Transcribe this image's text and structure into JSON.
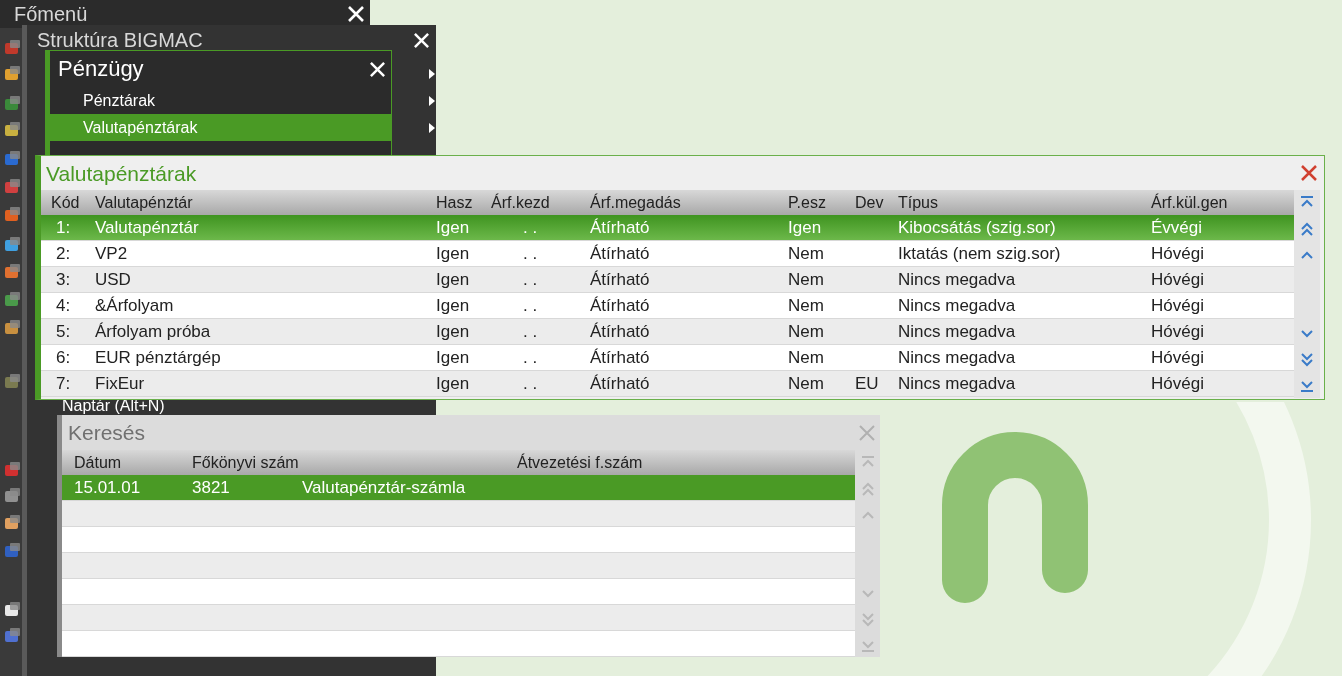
{
  "main_menu": {
    "title": "Főmenü"
  },
  "structure_window": {
    "title": "Struktúra BIGMAC",
    "items": [
      {
        "label": "Naptár (Alt+N)"
      }
    ]
  },
  "finance_menu": {
    "title": "Pénzügy",
    "items": [
      {
        "label": "Pénztárak",
        "selected": false
      },
      {
        "label": "Valutapénztárak",
        "selected": true
      }
    ]
  },
  "currency_window": {
    "title": "Valutapénztárak",
    "table": {
      "columns": [
        "Kód",
        "Valutapénztár",
        "Hasz",
        "Árf.kezd",
        "Árf.megadás",
        "P.esz",
        "Dev",
        "Típus",
        "Árf.kül.gen"
      ],
      "rows": [
        {
          "selected": true,
          "cells": [
            "1:",
            "Valutapénztár",
            "Igen",
            ". .",
            "Átírható",
            "Igen",
            "",
            "Kibocsátás (szig.sor)",
            "Évvégi"
          ]
        },
        {
          "selected": false,
          "cells": [
            "2:",
            "VP2",
            "Igen",
            ". .",
            "Átírható",
            "Nem",
            "",
            "Iktatás (nem szig.sor)",
            "Hóvégi"
          ]
        },
        {
          "selected": false,
          "cells": [
            "3:",
            "USD",
            "Igen",
            ". .",
            "Átírható",
            "Nem",
            "",
            "Nincs megadva",
            "Hóvégi"
          ]
        },
        {
          "selected": false,
          "cells": [
            "4:",
            "&Árfolyam",
            "Igen",
            ". .",
            "Átírható",
            "Nem",
            "",
            "Nincs megadva",
            "Hóvégi"
          ]
        },
        {
          "selected": false,
          "cells": [
            "5:",
            "Árfolyam próba",
            "Igen",
            ". .",
            "Átírható",
            "Nem",
            "",
            "Nincs megadva",
            "Hóvégi"
          ]
        },
        {
          "selected": false,
          "cells": [
            "6:",
            "EUR pénztárgép",
            "Igen",
            ". .",
            "Átírható",
            "Nem",
            "",
            "Nincs megadva",
            "Hóvégi"
          ]
        },
        {
          "selected": false,
          "cells": [
            "7:",
            "FixEur",
            "Igen",
            ". .",
            "Átírható",
            "Nem",
            "EU",
            "Nincs megadva",
            "Hóvégi"
          ]
        }
      ]
    }
  },
  "search_window": {
    "title": "Keresés",
    "table": {
      "columns": [
        "Dátum",
        "Főkönyvi szám",
        "Átvezetési f.szám"
      ],
      "rows": [
        {
          "selected": true,
          "cells": [
            "15.01.01",
            "3821",
            "Valutapénztár-számla",
            ""
          ]
        }
      ]
    }
  }
}
